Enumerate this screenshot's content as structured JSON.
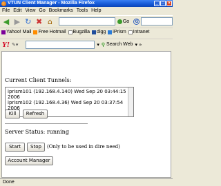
{
  "window": {
    "title": "VTUN Client Manager - Mozilla Firefox"
  },
  "menu": [
    "File",
    "Edit",
    "View",
    "Go",
    "Bookmarks",
    "Tools",
    "Help"
  ],
  "nav": {
    "go_label": "Go"
  },
  "bookmarks": [
    "Yahoo! Mail",
    "Free Hotmail",
    "Bugzilla",
    "digg",
    "iPrism",
    "Intranet"
  ],
  "yahoo": {
    "logo": "Y!",
    "search_label": "Search Web"
  },
  "page": {
    "heading": "Current Client Tunnels:",
    "tunnels": [
      "iprism101 (192.168.4.140) Wed Sep 20 03:44:15 2006",
      "iprism102 (192.168.4.36) Wed Sep 20 03:37:54 2006"
    ],
    "kill_label": "Kill",
    "refresh_label": "Refresh",
    "server_status": "Server Status: running",
    "start_label": "Start",
    "stop_label": "Stop",
    "note": "(Only to be used in dire need)",
    "account_label": "Account Manager"
  },
  "statusbar": {
    "text": "Done"
  }
}
